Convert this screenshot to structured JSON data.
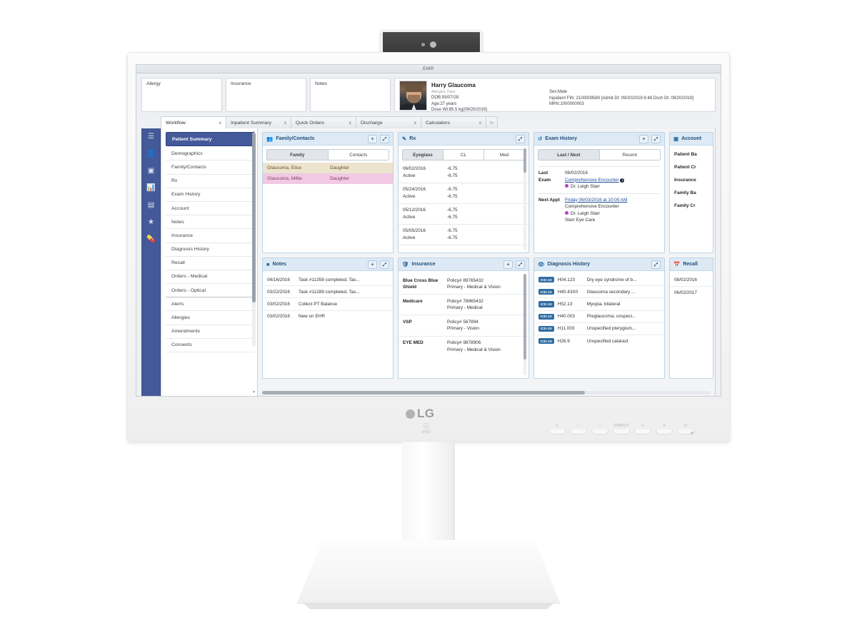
{
  "hardware": {
    "brand": "LG",
    "rfid_label": "RFID",
    "osd_keys": [
      "⠿",
      "‹",
      "›",
      "⏻INPUT",
      "∨",
      "∧",
      "⏻"
    ]
  },
  "app": {
    "title": "EMR"
  },
  "patient_header": {
    "cards": [
      {
        "label": "Allergy"
      },
      {
        "label": "Insurance"
      },
      {
        "label": "Notes"
      }
    ],
    "name": "Harry Glaucoma",
    "allergies": "Allergies: Dairy",
    "dob": "DOB:93/07/28",
    "age": "Age:27 years",
    "dose_wt": "Dose Wt:85.5 kg(09/20/2019)",
    "sex": "Sex:Male",
    "inpatient_fin": "Inpatient FIN: 2100009580 [Admit Dt: 09/20/2019 6:48 Dsch Dt: 09/20/2019]",
    "mrn": "MRN:1000000003"
  },
  "tabs": {
    "items": [
      {
        "label": "Workflow",
        "close": "x",
        "active": true
      },
      {
        "label": "Inpatient Summary",
        "close": "x",
        "active": false
      },
      {
        "label": "Quick Orders",
        "close": "x",
        "active": false
      },
      {
        "label": "Discharge",
        "close": "x",
        "active": false
      },
      {
        "label": "Calculators",
        "close": "x",
        "active": false
      }
    ],
    "overflow": "››"
  },
  "icon_rail": {
    "items": [
      {
        "name": "menu-icon",
        "glyph": "☰"
      },
      {
        "name": "patient-icon",
        "glyph": "👤"
      },
      {
        "name": "card-icon",
        "glyph": "▣"
      },
      {
        "name": "chart-icon",
        "glyph": "📊"
      },
      {
        "name": "document-icon",
        "glyph": "▤"
      },
      {
        "name": "star-icon",
        "glyph": "★"
      },
      {
        "name": "pill-icon",
        "glyph": "💊"
      }
    ]
  },
  "workflow": {
    "items": [
      {
        "label": "Patient Summary",
        "selected": true
      },
      {
        "label": "Demographics"
      },
      {
        "label": "Family/Contacts"
      },
      {
        "label": "Rx"
      },
      {
        "label": "Exam History"
      },
      {
        "label": "Account"
      },
      {
        "label": "Notes"
      },
      {
        "label": "Insurance"
      },
      {
        "label": "Diagnosis History"
      },
      {
        "label": "Recall"
      },
      {
        "label": "Orders - Medical"
      },
      {
        "label": "Orders - Optical",
        "group_end": true
      },
      {
        "label": "Alerts"
      },
      {
        "label": "Allergies"
      },
      {
        "label": "Amendments"
      },
      {
        "label": "Consents"
      }
    ]
  },
  "panels": {
    "family_contacts": {
      "title": "Family/Contacts",
      "icon": "people-icon",
      "add_label": "+",
      "expand_label": "⤢",
      "tabs": [
        {
          "label": "Family",
          "active": true
        },
        {
          "label": "Contacts",
          "active": false
        }
      ],
      "rows": [
        {
          "name": "Glaucoma, Elise",
          "relation": "Daughter",
          "tone": "tan"
        },
        {
          "name": "Glaucoma, Millie",
          "relation": "Daughter",
          "tone": "pink"
        }
      ]
    },
    "rx": {
      "title": "Rx",
      "icon": "prescription-icon",
      "expand_label": "⤢",
      "tabs": [
        {
          "label": "Eyeglass",
          "active": true
        },
        {
          "label": "CL",
          "active": false
        },
        {
          "label": "Med",
          "active": false
        }
      ],
      "rows": [
        {
          "date": "06/02/2016",
          "status": "Active",
          "od": "-6.75",
          "os": "-6.75"
        },
        {
          "date": "05/24/2016",
          "status": "Active",
          "od": "-6.75",
          "os": "-6.75"
        },
        {
          "date": "05/12/2016",
          "status": "Active",
          "od": "-6.75",
          "os": "-6.75"
        },
        {
          "date": "05/05/2016",
          "status": "Active",
          "od": "-6.75",
          "os": "-6.75"
        }
      ]
    },
    "exam_history": {
      "title": "Exam History",
      "icon": "history-icon",
      "add_label": "+",
      "expand_label": "⤢",
      "tabs": [
        {
          "label": "Last / Next",
          "active": true
        },
        {
          "label": "Recent",
          "active": false
        }
      ],
      "last_exam_label": "Last Exam",
      "last_exam_date": "06/02/2016",
      "last_exam_type": "Comprehensive Encounter",
      "last_exam_provider": "Dr. Leigh Starr",
      "next_appt_label": "Next Appt",
      "next_appt_when": "Friday 06/03/2016 at 10:00 AM",
      "next_appt_type": "Comprehensive Encounter",
      "next_appt_provider": "Dr. Leigh Starr",
      "next_appt_location": "Starr Eye Care"
    },
    "account": {
      "title": "Account",
      "icon": "money-icon",
      "items": [
        "Patient Ba",
        "Patient Cr",
        "Insurance",
        "Family Ba",
        "Family Cr"
      ]
    },
    "notes": {
      "title": "Notes",
      "icon": "note-icon",
      "add_label": "+",
      "expand_label": "⤢",
      "rows": [
        {
          "date": "04/16/2016",
          "text": "Task #11358 completed. Tas..."
        },
        {
          "date": "03/22/2016",
          "text": "Task #11289 completed. Tas..."
        },
        {
          "date": "03/02/2016",
          "text": "Collect PT Balance"
        },
        {
          "date": "03/02/2016",
          "text": "New on EHR"
        }
      ]
    },
    "insurance": {
      "title": "Insurance",
      "icon": "shield-icon",
      "add_label": "+",
      "expand_label": "⤢",
      "rows": [
        {
          "payer": "Blue Cross Blue Shield",
          "policy": "Policy# 89765432",
          "plan": "Primary - Medical & Vision"
        },
        {
          "payer": "Medicare",
          "policy": "Policy# 78965432",
          "plan": "Primary - Medical"
        },
        {
          "payer": "VSP",
          "policy": "Policy# 567894",
          "plan": "Primary - Vision"
        },
        {
          "payer": "EYE MED",
          "policy": "Policy# 9878906",
          "plan": "Primary - Medical & Vision"
        }
      ]
    },
    "diagnosis_history": {
      "title": "Diagnosis History",
      "icon": "eye-icon",
      "expand_label": "⤢",
      "badge": "ICD-10",
      "rows": [
        {
          "code": "H04.123",
          "desc": "Dry eye syndrome of b..."
        },
        {
          "code": "H40.43X0",
          "desc": "Glaucoma secondary ..."
        },
        {
          "code": "H52.13",
          "desc": "Myopia, bilateral"
        },
        {
          "code": "H40.003",
          "desc": "Preglaucoma, unspeci..."
        },
        {
          "code": "H11.003",
          "desc": "Unspecified pterygium..."
        },
        {
          "code": "H26.9",
          "desc": "Unspecified cataract"
        }
      ]
    },
    "recall": {
      "title": "Recall",
      "icon": "calendar-icon",
      "rows": [
        {
          "date": "08/02/2016"
        },
        {
          "date": "06/02/2017"
        }
      ]
    }
  }
}
